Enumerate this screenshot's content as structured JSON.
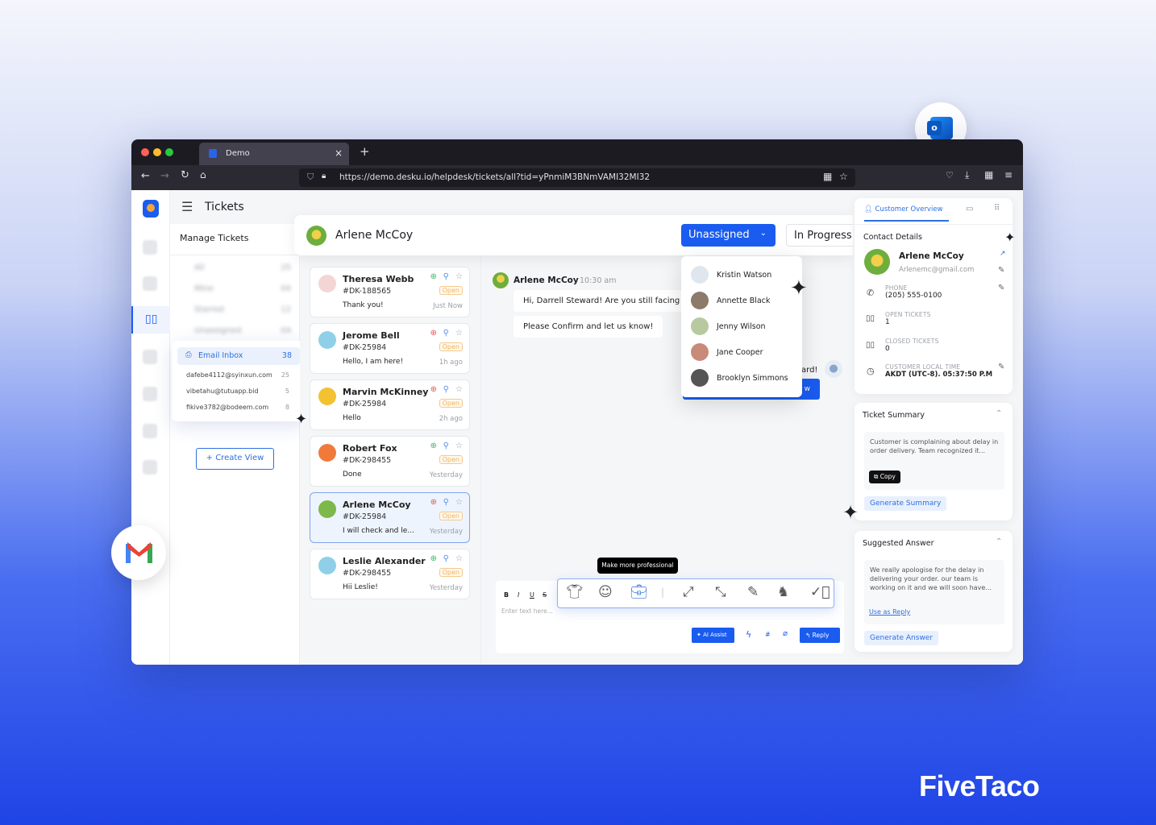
{
  "browser": {
    "tab_title": "Demo",
    "url": "https://demo.desku.io/helpdesk/tickets/all?tid=yPnmiM3BNmVAMI32MI32"
  },
  "header": {
    "title": "Tickets",
    "contact_name": "Arlene McCoy",
    "assign_button": "Unassigned",
    "status_button": "In Progress"
  },
  "sidebar": {
    "title": "Manage Tickets",
    "views": [
      {
        "label": "All",
        "count": "25"
      },
      {
        "label": "Mine",
        "count": "04"
      },
      {
        "label": "Starred",
        "count": "12"
      },
      {
        "label": "Unassigned",
        "count": "04"
      }
    ],
    "inbox": {
      "label": "Email Inbox",
      "count": "38",
      "accounts": [
        {
          "email": "dafebe4112@syinxun.com",
          "count": "25"
        },
        {
          "email": "vibetahu@tutuapp.bid",
          "count": "5"
        },
        {
          "email": "fikive3782@bodeem.com",
          "count": "8"
        }
      ]
    },
    "create_view": "+ Create View"
  },
  "tickets": [
    {
      "name": "Theresa Webb",
      "id": "#DK-188565",
      "status": "Open",
      "message": "Thank you!",
      "time": "Just Now",
      "priority_color": "#3fb56b"
    },
    {
      "name": "Jerome Bell",
      "id": "#DK-25984",
      "status": "Open",
      "message": "Hello, I am here!",
      "time": "1h ago",
      "priority_color": "#e05a5a"
    },
    {
      "name": "Marvin McKinney",
      "id": "#DK-25984",
      "status": "Open",
      "message": "Hello",
      "time": "2h ago",
      "priority_color": "#e05a5a"
    },
    {
      "name": "Robert Fox",
      "id": "#DK-298455",
      "status": "Open",
      "message": "Done",
      "time": "Yesterday",
      "priority_color": "#3fb56b"
    },
    {
      "name": "Arlene McCoy",
      "id": "#DK-25984",
      "status": "Open",
      "message": "I will check and le...",
      "time": "Yesterday",
      "priority_color": "#e05a5a"
    },
    {
      "name": "Leslie Alexander",
      "id": "#DK-298455",
      "status": "Open",
      "message": "Hii Leslie!",
      "time": "Yesterday",
      "priority_color": "#3fb56b"
    }
  ],
  "chat": {
    "sender": "Arlene McCoy",
    "time": "10:30 am",
    "messages": [
      "Hi, Darrell Steward! Are you still facing th",
      "Please Confirm and let us know!"
    ],
    "agent_message_fragment": "ard!",
    "button_fragment": "w"
  },
  "assign_dropdown": [
    "Kristin Watson",
    "Annette Black",
    "Jenny Wilson",
    "Jane Cooper",
    "Brooklyn Simmons"
  ],
  "composer": {
    "format": [
      "B",
      "I",
      "U",
      "S"
    ],
    "placeholder": "Enter text here...",
    "tooltip": "Make more professional",
    "ai_assist": "AI Assist",
    "reply": "Reply",
    "ai_tools": [
      "tone-casual-icon",
      "emoji-icon",
      "briefcase-professional-icon",
      "expand-icon",
      "shorten-icon",
      "pencil-rewrite-icon",
      "rocking-horse-simplify-icon",
      "check-grammar-icon"
    ]
  },
  "right_panel": {
    "tab": "Customer Overview",
    "contact_title": "Contact Details",
    "name": "Arlene McCoy",
    "email": "Arlenemc@gmail.com",
    "fields": [
      {
        "label": "PHONE",
        "value": "(205) 555-0100"
      },
      {
        "label": "OPEN TICKETS",
        "value": "1"
      },
      {
        "label": "CLOSED TICKETS",
        "value": "0"
      },
      {
        "label": "CUSTOMER LOCAL TIME",
        "value": "AKDT (UTC-8). 05:37:50 P.M"
      }
    ],
    "summary": {
      "title": "Ticket Summary",
      "text": "Customer is complaining about delay in order delivery. Team recognized it...",
      "copy": "Copy",
      "generate": "Generate Summary"
    },
    "suggested": {
      "title": "Suggested Answer",
      "text": "We really apologise for the delay in delivering your order. our team is working on it and we will soon have...",
      "use": "Use as Reply",
      "generate": "Generate Answer"
    }
  },
  "brand": {
    "logo": "FiveTaco"
  },
  "colors": {
    "accent": "#1a5cf0",
    "open_badge": "#f0b45a"
  }
}
